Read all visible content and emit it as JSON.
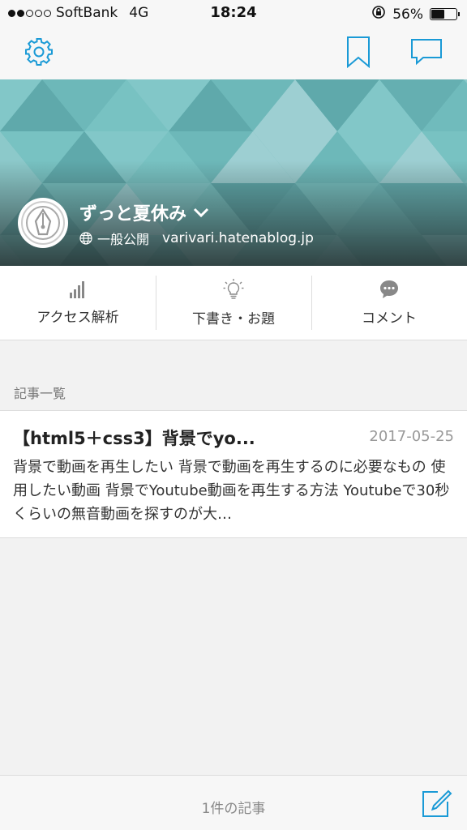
{
  "status_bar": {
    "carrier": "SoftBank",
    "network": "4G",
    "time": "18:24",
    "battery_text": "56%",
    "battery_level": 0.56,
    "signal_bars_filled": 2,
    "signal_bars_total": 5
  },
  "nav": {
    "settings_icon": "gear-icon",
    "bookmark_icon": "bookmark-icon",
    "comment_icon": "speech-bubble-icon",
    "accent_color": "#1a9ad6"
  },
  "blog": {
    "title": "ずっと夏休み",
    "visibility": "一般公開",
    "url": "varivari.hatenablog.jp"
  },
  "tabs": [
    {
      "label": "アクセス解析",
      "icon": "bar-chart-icon"
    },
    {
      "label": "下書き・お題",
      "icon": "lightbulb-icon"
    },
    {
      "label": "コメント",
      "icon": "comment-bubble-icon"
    }
  ],
  "entries_section": {
    "label": "記事一覧"
  },
  "entries": [
    {
      "title": "【html5＋css3】背景でyo...",
      "date": "2017-05-25",
      "excerpt": "背景で動画を再生したい 背景で動画を再生するのに必要なもの 使用したい動画 背景でYoutube動画を再生する方法 Youtubeで30秒くらいの無音動画を探すのが大…"
    }
  ],
  "footer": {
    "count_label": "1件の記事",
    "compose_icon": "compose-icon"
  }
}
